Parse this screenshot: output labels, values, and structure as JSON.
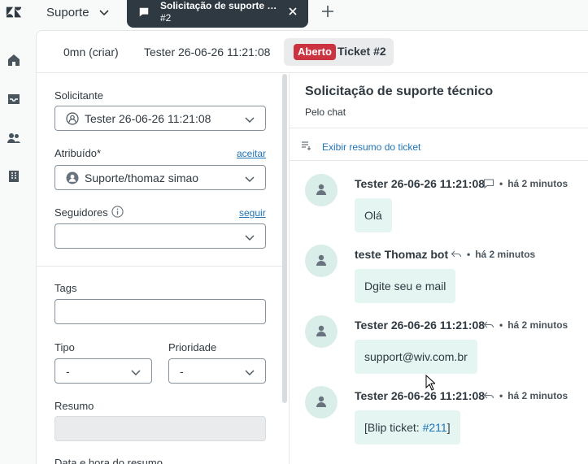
{
  "topbar": {
    "product": "Suporte",
    "tab": {
      "title": "Solicitação de suporte t...",
      "subtitle": "#2"
    }
  },
  "nav": {
    "icons": [
      "home-icon",
      "inbox-icon",
      "users-icon",
      "building-icon"
    ]
  },
  "subheader": {
    "item1": "0mn (criar)",
    "item2": "Tester 26-06-26 11:21:08",
    "status_badge": "Aberto",
    "ticket_label": "Ticket #2"
  },
  "props": {
    "requester_label": "Solicitante",
    "requester_value": "Tester 26-06-26 11:21:08",
    "assignee_label": "Atribuído*",
    "assignee_link": "aceitar",
    "assignee_value": "Suporte/thomaz simao",
    "followers_label": "Seguidores",
    "followers_link": "seguir",
    "followers_value": "",
    "tags_label": "Tags",
    "tags_value": "",
    "type_label": "Tipo",
    "type_value": "-",
    "priority_label": "Prioridade",
    "priority_value": "-",
    "summary_label": "Resumo",
    "summary_datetime_label": "Data e hora do resumo"
  },
  "conversation": {
    "title": "Solicitação de suporte técnico",
    "channel": "Pelo chat",
    "summary_link": "Exibir resumo do ticket",
    "messages": [
      {
        "author": "Tester 26-06-26 11:21:08",
        "dot": "•",
        "time": "há 2 minutos",
        "text": "Olá",
        "source_icon": "chat-bubble-icon"
      },
      {
        "author": "teste Thomaz bot",
        "dot": "•",
        "time": "há 2 minutos",
        "text": "Dgite seu e mail",
        "source_icon": "reply-icon"
      },
      {
        "author": "Tester 26-06-26 11:21:08",
        "dot": "•",
        "time": "há 2 minutos",
        "text": "support@wiv.com.br",
        "source_icon": "reply-icon"
      },
      {
        "author": "Tester 26-06-26 11:21:08",
        "dot": "•",
        "time": "há 2 minutos",
        "text_prefix": "[Blip ticket: ",
        "text_link": "#211",
        "text_suffix": "]",
        "source_icon": "reply-icon"
      }
    ]
  },
  "colors": {
    "accent": "#1f73b7",
    "badge_open": "#cc3340",
    "bubble": "#e4f5f2",
    "avatar_bg": "#d9ede9",
    "tab_dark": "#2f3941"
  }
}
